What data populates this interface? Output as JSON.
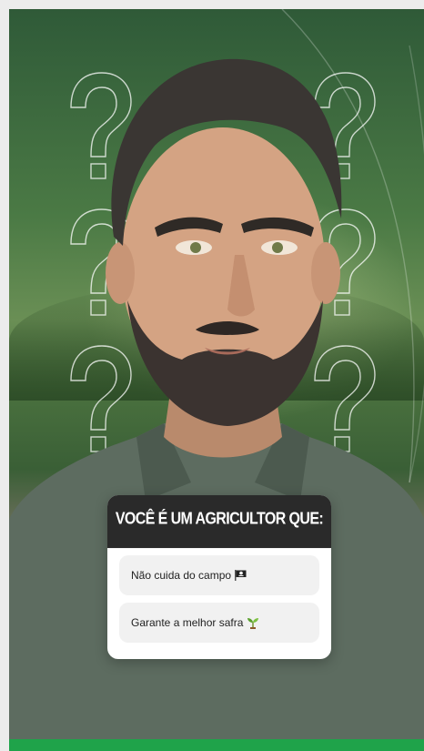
{
  "poll": {
    "question": "VOCÊ É UM AGRICULTOR QUE:",
    "options": [
      {
        "label": "Não cuida do campo",
        "icon": "pirate-flag-icon"
      },
      {
        "label": "Garante a melhor safra",
        "icon": "seedling-icon"
      }
    ]
  },
  "colors": {
    "question_bg": "#2a2a2a",
    "option_bg": "#f1f1f1",
    "accent_bar": "#1fa34a"
  }
}
